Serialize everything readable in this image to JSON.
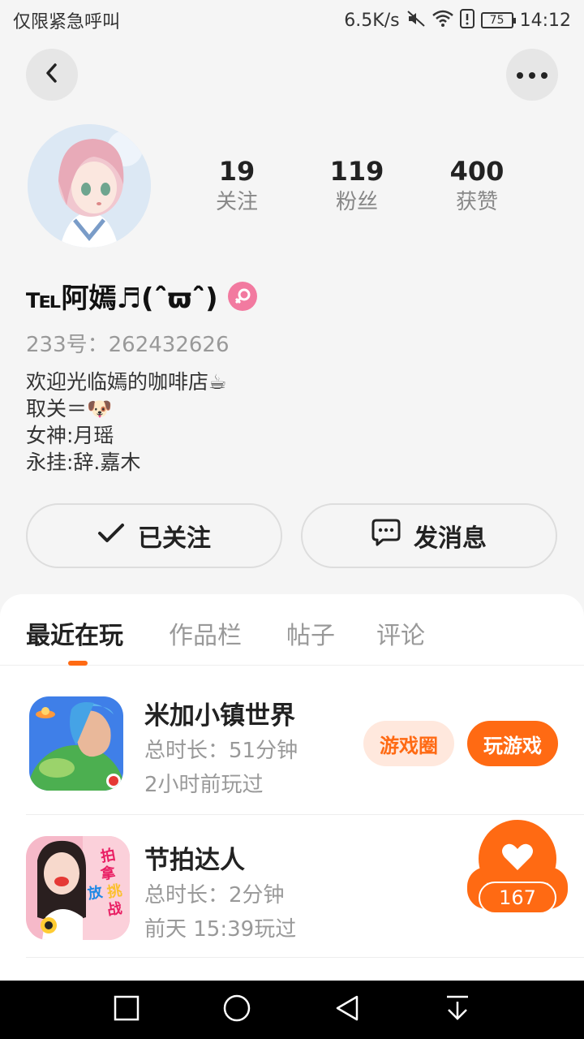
{
  "status_bar": {
    "carrier": "仅限紧急呼叫",
    "speed": "6.5K/s",
    "battery": "75",
    "time": "14:12",
    "icons": [
      "mute-icon",
      "wifi-icon",
      "sim-alert-icon",
      "battery-icon"
    ]
  },
  "header": {
    "back_icon": "chevron-left-icon",
    "more_icon": "more-dots-icon"
  },
  "profile": {
    "stats": [
      {
        "value": "19",
        "label": "关注"
      },
      {
        "value": "119",
        "label": "粉丝"
      },
      {
        "value": "400",
        "label": "获赞"
      }
    ],
    "name": "℡阿嫣♬(ˆ̑ϖˆ̑)",
    "gender_icon": "female-icon",
    "uid": "233号：262432626",
    "bio": [
      "欢迎光临嫣的咖啡店☕",
      "取关＝🐶",
      "女神:月瑶",
      "永挂:辞.嘉木"
    ]
  },
  "actions": {
    "follow_label": "已关注",
    "message_label": "发消息"
  },
  "tabs": [
    "最近在玩",
    "作品栏",
    "帖子",
    "评论"
  ],
  "games": [
    {
      "title": "米加小镇世界",
      "duration": "总时长：51分钟",
      "last_played": "2小时前玩过",
      "circle_label": "游戏圈",
      "play_label": "玩游戏"
    },
    {
      "title": "节拍达人",
      "duration": "总时长：2分钟",
      "last_played": "前天 15:39玩过",
      "icon_text": [
        "拍",
        "拿",
        "放",
        "挑",
        "战"
      ]
    }
  ],
  "like_float": {
    "count": "167",
    "icon": "heart-icon"
  },
  "colors": {
    "accent": "#ff6a13",
    "accent_light": "#ffe8dd",
    "gender": "#f27aa0"
  }
}
